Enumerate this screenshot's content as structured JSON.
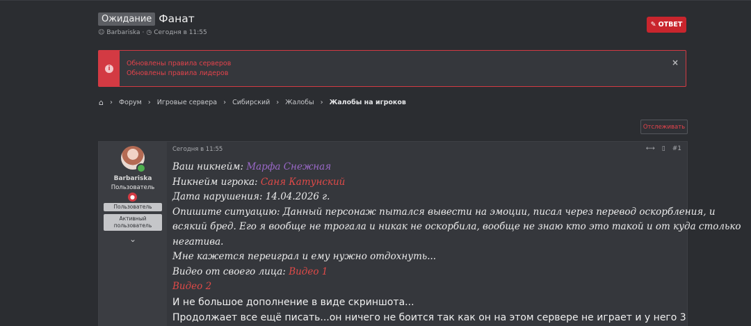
{
  "thread": {
    "prefix": "Ожидание",
    "title": "Фанат",
    "author": "Barbariska",
    "date": "Сегодня в 11:55"
  },
  "reply_button": {
    "label": "ОТВЕТ"
  },
  "notice": {
    "lines": [
      "Обновлены правила серверов",
      "Обновлены правила лидеров"
    ],
    "close": "×"
  },
  "breadcrumbs": [
    "Форум",
    "Игровые сервера",
    "Сибирский",
    "Жалобы",
    "Жалобы на игроков"
  ],
  "watch_button": {
    "label": "Отслеживать"
  },
  "post": {
    "user": {
      "name": "Barbariska",
      "role": "Пользователь",
      "banners": [
        "Пользователь",
        "Активный пользователь"
      ]
    },
    "date": "Сегодня в 11:55",
    "number": "#1",
    "lines": {
      "nick_label": "Ваш никнейм: ",
      "nick_value": "Марфа Снежная",
      "player_label": "Никнейм игрока: ",
      "player_value": "Саня Катунский",
      "date_line": "Дата нарушения: 14.04.2026 г.",
      "situation_1": "Опишите ситуацию: Данный персонаж пытался вывести на эмоции, писал через перевод оскорбления, и",
      "situation_2": "всякий бред. Его я вообще не трогала и никак не оскорбила, вообще не знаю кто это такой и от куда столько",
      "situation_3": "негатива.",
      "situation_4": "Мне кажется переиграл и ему нужно отдохнуть...",
      "video_label": "Видео от своего лица: ",
      "video_1": "Видео 1",
      "video_2": "Видео 2",
      "extra_1": "И не большое дополнение в виде скриншота...",
      "extra_2": "Продолжает все ещё писать...он ничего не боится так как он на этом сервере не играет и у него 3"
    }
  },
  "colors": {
    "accent_red": "#c9252d",
    "nick_purple": "#9a68c8",
    "link_red": "#e14a48"
  }
}
